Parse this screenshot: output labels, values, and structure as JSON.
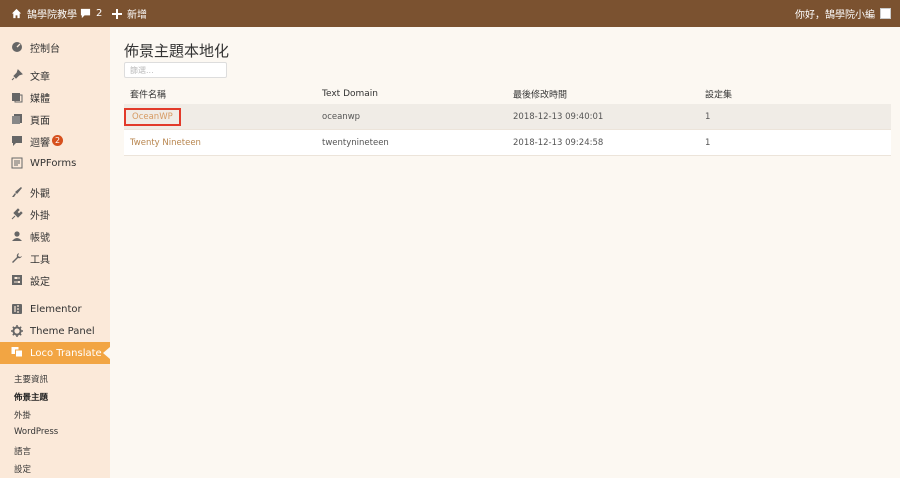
{
  "adminbar": {
    "site_name": "鵠學院教學",
    "comments_count": "2",
    "new_label": "新增",
    "greeting": "你好，鵠學院小編"
  },
  "sidebar": {
    "items": [
      {
        "label": "控制台",
        "icon": "dashboard-icon"
      },
      {
        "label": "文章",
        "icon": "pin-icon"
      },
      {
        "label": "媒體",
        "icon": "media-icon"
      },
      {
        "label": "頁面",
        "icon": "pages-icon"
      },
      {
        "label": "迴響",
        "icon": "comment-icon",
        "badge": "2"
      },
      {
        "label": "WPForms",
        "icon": "forms-icon"
      },
      {
        "label": "外觀",
        "icon": "brush-icon"
      },
      {
        "label": "外掛",
        "icon": "plugin-icon"
      },
      {
        "label": "帳號",
        "icon": "user-icon"
      },
      {
        "label": "工具",
        "icon": "wrench-icon"
      },
      {
        "label": "設定",
        "icon": "settings-icon"
      },
      {
        "label": "Elementor",
        "icon": "elementor-icon"
      },
      {
        "label": "Theme Panel",
        "icon": "gear-icon"
      },
      {
        "label": "Loco Translate",
        "icon": "translate-icon"
      }
    ],
    "submenu": [
      "主要資訊",
      "佈景主題",
      "外掛",
      "WordPress",
      "語言",
      "設定"
    ]
  },
  "main": {
    "title": "佈景主題本地化",
    "filter_placeholder": "篩選...",
    "columns": [
      "套件名稱",
      "Text Domain",
      "最後修改時間",
      "設定集"
    ],
    "rows": [
      {
        "name": "OceanWP",
        "domain": "oceanwp",
        "modified": "2018-12-13 09:40:01",
        "sets": "1"
      },
      {
        "name": "Twenty Nineteen",
        "domain": "twentynineteen",
        "modified": "2018-12-13 09:24:58",
        "sets": "1"
      }
    ]
  },
  "colors": {
    "adminbar": "#7b5230",
    "sidebar": "#fbe9d9",
    "active": "#f2a543",
    "highlight": "#e23a2a",
    "link": "#b8864f"
  }
}
